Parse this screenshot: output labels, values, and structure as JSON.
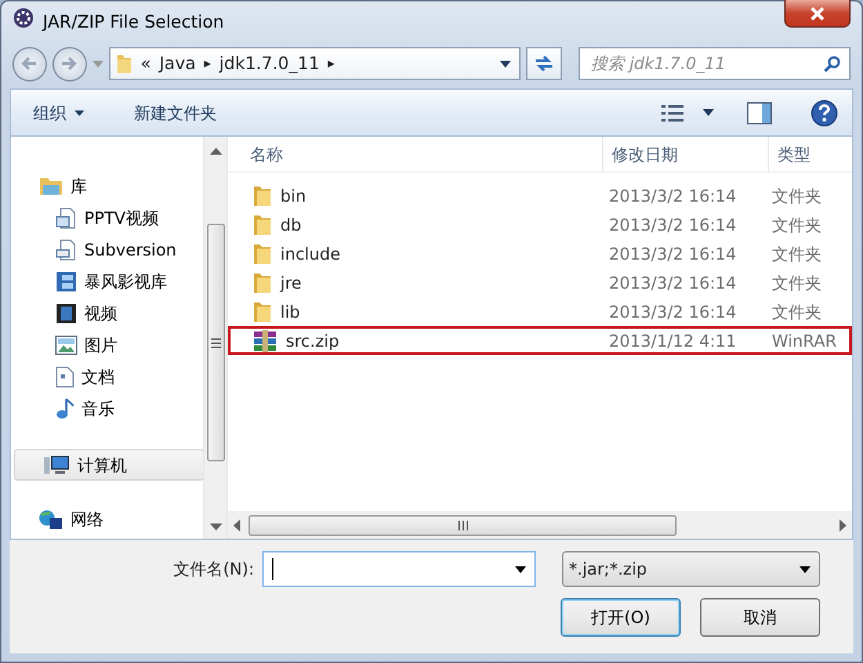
{
  "window": {
    "title": "JAR/ZIP File Selection"
  },
  "address": {
    "overflow": "«",
    "crumbs": [
      {
        "label": "Java",
        "separator": "▸"
      },
      {
        "label": "jdk1.7.0_11",
        "separator": "▸"
      }
    ]
  },
  "search": {
    "placeholder": "搜索 jdk1.7.0_11"
  },
  "toolbar": {
    "organize": "组织",
    "new_folder": "新建文件夹"
  },
  "nav": [
    {
      "label": "库",
      "selected": false,
      "children": [
        {
          "label": "PPTV视频",
          "selected": false
        },
        {
          "label": "Subversion",
          "selected": false
        },
        {
          "label": "暴风影视库",
          "selected": false
        },
        {
          "label": "视频",
          "selected": false
        },
        {
          "label": "图片",
          "selected": false
        },
        {
          "label": "文档",
          "selected": false
        },
        {
          "label": "音乐",
          "selected": false
        }
      ]
    },
    {
      "label": "计算机",
      "selected": true
    },
    {
      "label": "网络",
      "selected": false
    }
  ],
  "table": {
    "columns": [
      "名称",
      "修改日期",
      "类型"
    ],
    "rows": [
      {
        "kind": "folder",
        "name": "bin",
        "date": "2013/3/2 16:14",
        "type": "文件夹",
        "highlighted": false
      },
      {
        "kind": "folder",
        "name": "db",
        "date": "2013/3/2 16:14",
        "type": "文件夹",
        "highlighted": false
      },
      {
        "kind": "folder",
        "name": "include",
        "date": "2013/3/2 16:14",
        "type": "文件夹",
        "highlighted": false
      },
      {
        "kind": "folder",
        "name": "jre",
        "date": "2013/3/2 16:14",
        "type": "文件夹",
        "highlighted": false
      },
      {
        "kind": "folder",
        "name": "lib",
        "date": "2013/3/2 16:14",
        "type": "文件夹",
        "highlighted": false
      },
      {
        "kind": "archive",
        "name": "src.zip",
        "date": "2013/1/12 4:11",
        "type": "WinRAR",
        "highlighted": true
      }
    ]
  },
  "filename": {
    "label": "文件名(N):"
  },
  "filter": {
    "value": "*.jar;*.zip"
  },
  "buttons": [
    {
      "label": "打开(O)",
      "default": true
    },
    {
      "label": "取消",
      "default": false
    }
  ]
}
